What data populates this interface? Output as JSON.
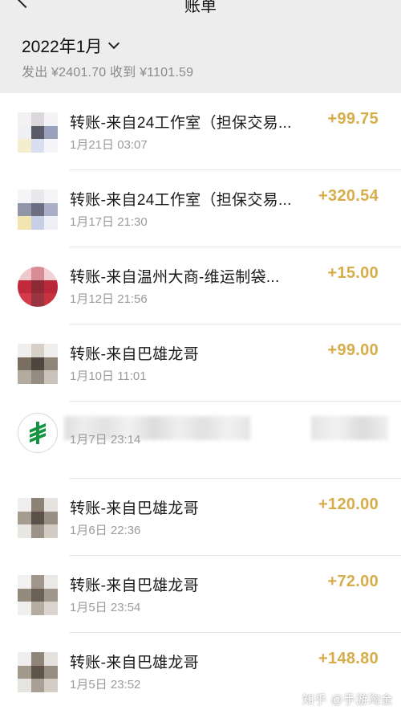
{
  "header": {
    "title": "账单"
  },
  "month": {
    "label": "2022年1月",
    "summary": "发出 ¥2401.70 收到 ¥1101.59"
  },
  "colors": {
    "income": "#d6ad4a",
    "header_bg": "#ededed",
    "post_green": "#159442"
  },
  "transactions": [
    {
      "name": "转账-来自24工作室（担保交易...",
      "time": "1月21日 03:07",
      "amount": "+99.75",
      "avatar": "mosaic-gray-blue"
    },
    {
      "name": "转账-来自24工作室（担保交易...",
      "time": "1月17日 21:30",
      "amount": "+320.54",
      "avatar": "mosaic-gray-blue"
    },
    {
      "name": "转账-来自温州大商-维运制袋...",
      "time": "1月12日 21:56",
      "amount": "+15.00",
      "avatar": "mosaic-red"
    },
    {
      "name": "转账-来自巴雄龙哥",
      "time": "1月10日 11:01",
      "amount": "+99.00",
      "avatar": "mosaic-brown"
    },
    {
      "name": "",
      "time": "1月7日 23:14",
      "amount": "",
      "avatar": "china-post-icon"
    },
    {
      "name": "转账-来自巴雄龙哥",
      "time": "1月6日 22:36",
      "amount": "+120.00",
      "avatar": "mosaic-brown"
    },
    {
      "name": "转账-来自巴雄龙哥",
      "time": "1月5日 23:54",
      "amount": "+72.00",
      "avatar": "mosaic-brown"
    },
    {
      "name": "转账-来自巴雄龙哥",
      "time": "1月5日 23:52",
      "amount": "+148.80",
      "avatar": "mosaic-brown"
    }
  ],
  "watermark": "知乎 @手游淘金"
}
